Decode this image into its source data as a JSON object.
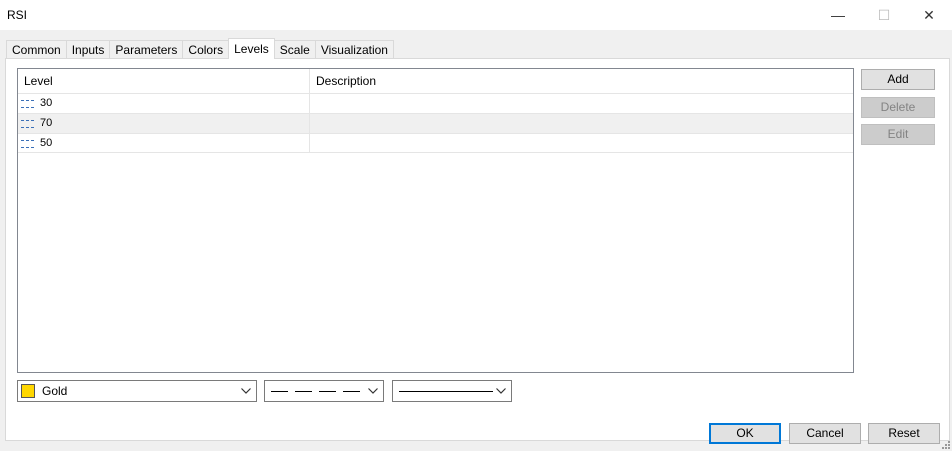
{
  "window": {
    "title": "RSI",
    "minimize_glyph": "—",
    "maximize_glyph": "☐",
    "close_glyph": "✕"
  },
  "tabs": [
    {
      "label": "Common",
      "active": false
    },
    {
      "label": "Inputs",
      "active": false
    },
    {
      "label": "Parameters",
      "active": false
    },
    {
      "label": "Colors",
      "active": false
    },
    {
      "label": "Levels",
      "active": true
    },
    {
      "label": "Scale",
      "active": false
    },
    {
      "label": "Visualization",
      "active": false
    }
  ],
  "levels": {
    "columns": [
      "Level",
      "Description"
    ],
    "rows": [
      {
        "level": "30",
        "description": "",
        "icon": "dotted-line-icon"
      },
      {
        "level": "70",
        "description": "",
        "icon": "dotted-line-icon",
        "selected": true
      },
      {
        "level": "50",
        "description": "",
        "icon": "dotted-line-icon"
      }
    ]
  },
  "side_buttons": {
    "add": "Add",
    "delete": "Delete",
    "edit": "Edit"
  },
  "style": {
    "color_name": "Gold",
    "color_hex": "#ffd700",
    "line_style": "dashed",
    "line_width": "thin-solid"
  },
  "footer": {
    "ok": "OK",
    "cancel": "Cancel",
    "reset": "Reset"
  }
}
